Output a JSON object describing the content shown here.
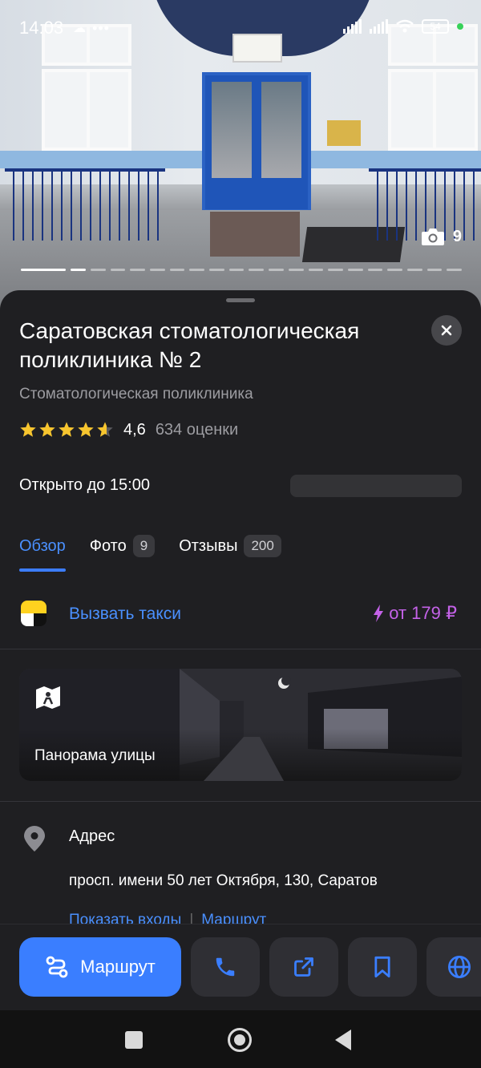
{
  "status_bar": {
    "time": "14:03",
    "battery": "54",
    "cloud_icon": "cloud-icon",
    "dots": "•••"
  },
  "photo": {
    "count": "9",
    "current_index_fraction": 0.05
  },
  "place": {
    "title": "Саратовская стоматологическая поликлиника № 2",
    "category": "Стоматологическая поликлиника",
    "rating": "4,6",
    "rating_stars": 4.6,
    "reviews_count_label": "634 оценки",
    "hours": "Открыто до 15:00"
  },
  "tabs": [
    {
      "label": "Обзор",
      "badge": null,
      "active": true
    },
    {
      "label": "Фото",
      "badge": "9",
      "active": false
    },
    {
      "label": "Отзывы",
      "badge": "200",
      "active": false
    }
  ],
  "taxi": {
    "label": "Вызвать такси",
    "price": "от 179 ₽",
    "accent_color": "#c462e8"
  },
  "panorama": {
    "label": "Панорама улицы"
  },
  "address": {
    "label": "Адрес",
    "value": "просп. имени 50 лет Октября, 130, Саратов",
    "link_entrances": "Показать входы",
    "link_separator": "|",
    "link_route": "Маршрут"
  },
  "actions": {
    "route_label": "Маршрут",
    "accent_color": "#3a7eff",
    "icons": [
      "phone-icon",
      "share-icon",
      "bookmark-icon",
      "globe-icon"
    ]
  }
}
